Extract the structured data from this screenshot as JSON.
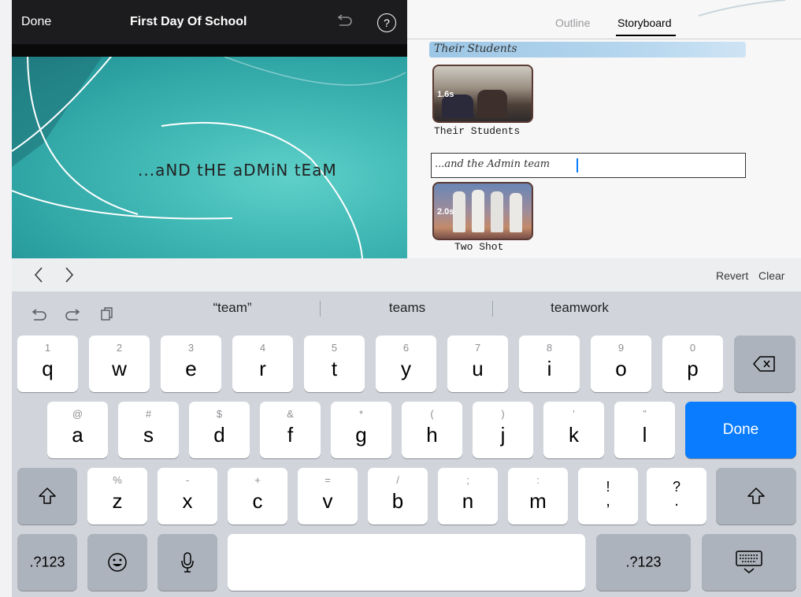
{
  "editor": {
    "done_label": "Done",
    "title": "First Day Of School",
    "undo_icon": "undo-arrow-icon",
    "help_icon": "question-mark-icon",
    "help_label": "?",
    "preview_text": "...aND tHE aDMiN tEaM"
  },
  "right": {
    "tabs": [
      {
        "label": "Outline",
        "active": false
      },
      {
        "label": "Storyboard",
        "active": true
      }
    ],
    "sections": [
      {
        "heading": "Their Students",
        "clip_duration": "1.6s",
        "clip_title": "Their Students"
      },
      {
        "heading": "...and the Admin team",
        "clip_duration": "2.0s",
        "clip_title": "Two Shot"
      }
    ]
  },
  "accessory": {
    "back_icon": "chevron-left-icon",
    "forward_icon": "chevron-right-icon",
    "revert_label": "Revert",
    "clear_label": "Clear"
  },
  "keyboard": {
    "suggestions": [
      "“team”",
      "teams",
      "teamwork"
    ],
    "row1": [
      {
        "hint": "1",
        "key": "q"
      },
      {
        "hint": "2",
        "key": "w"
      },
      {
        "hint": "3",
        "key": "e"
      },
      {
        "hint": "4",
        "key": "r"
      },
      {
        "hint": "5",
        "key": "t"
      },
      {
        "hint": "6",
        "key": "y"
      },
      {
        "hint": "7",
        "key": "u"
      },
      {
        "hint": "8",
        "key": "i"
      },
      {
        "hint": "9",
        "key": "o"
      },
      {
        "hint": "0",
        "key": "p"
      }
    ],
    "row2": [
      {
        "hint": "@",
        "key": "a"
      },
      {
        "hint": "#",
        "key": "s"
      },
      {
        "hint": "$",
        "key": "d"
      },
      {
        "hint": "&",
        "key": "f"
      },
      {
        "hint": "*",
        "key": "g"
      },
      {
        "hint": "(",
        "key": "h"
      },
      {
        "hint": ")",
        "key": "j"
      },
      {
        "hint": "’",
        "key": "k"
      },
      {
        "hint": "”",
        "key": "l"
      }
    ],
    "row3": [
      {
        "hint": "%",
        "key": "z"
      },
      {
        "hint": "-",
        "key": "x"
      },
      {
        "hint": "+",
        "key": "c"
      },
      {
        "hint": "=",
        "key": "v"
      },
      {
        "hint": "/",
        "key": "b"
      },
      {
        "hint": ";",
        "key": "n"
      },
      {
        "hint": ":",
        "key": "m"
      },
      {
        "hint": "!",
        "key": ","
      },
      {
        "hint": "?",
        "key": "."
      }
    ],
    "done_label": "Done",
    "numbers_label": ".?123",
    "accent_color": "#0a7cff"
  }
}
